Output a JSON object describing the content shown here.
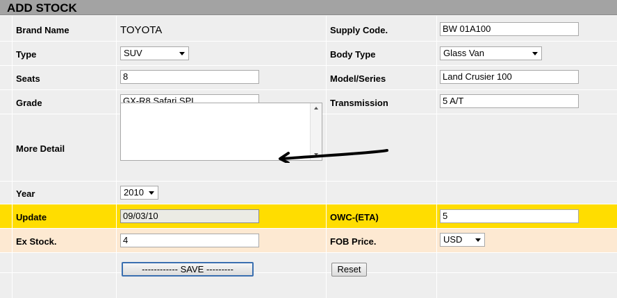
{
  "title": "ADD STOCK",
  "fields": {
    "brand_name": {
      "label": "Brand Name",
      "value": "TOYOTA"
    },
    "supply_code": {
      "label": "Supply Code.",
      "value": "BW 01A100"
    },
    "type": {
      "label": "Type",
      "value": "SUV"
    },
    "body_type": {
      "label": "Body Type",
      "value": "Glass Van"
    },
    "seats": {
      "label": "Seats",
      "value": "8"
    },
    "model_series": {
      "label": "Model/Series",
      "value": "Land Crusier 100"
    },
    "grade": {
      "label": "Grade",
      "value": "GX-R8 Safari SPL"
    },
    "transmission": {
      "label": "Transmission",
      "value": "5 A/T"
    },
    "more_detail": {
      "label": "More Detail",
      "value": ""
    },
    "year": {
      "label": "Year",
      "value": "2010"
    },
    "update": {
      "label": "Update",
      "value": "09/03/10"
    },
    "owc_eta": {
      "label": "OWC-(ETA)",
      "value": "5"
    },
    "ex_stock": {
      "label": "Ex Stock.",
      "value": "4"
    },
    "fob_price": {
      "label": "FOB Price.",
      "value": "USD"
    }
  },
  "buttons": {
    "save": "------------ SAVE ---------",
    "reset": "Reset"
  },
  "colors": {
    "header": "#a3a3a3",
    "highlight": "#ffdd00",
    "peach": "#fde9d2",
    "grid": "#eeeeee"
  }
}
